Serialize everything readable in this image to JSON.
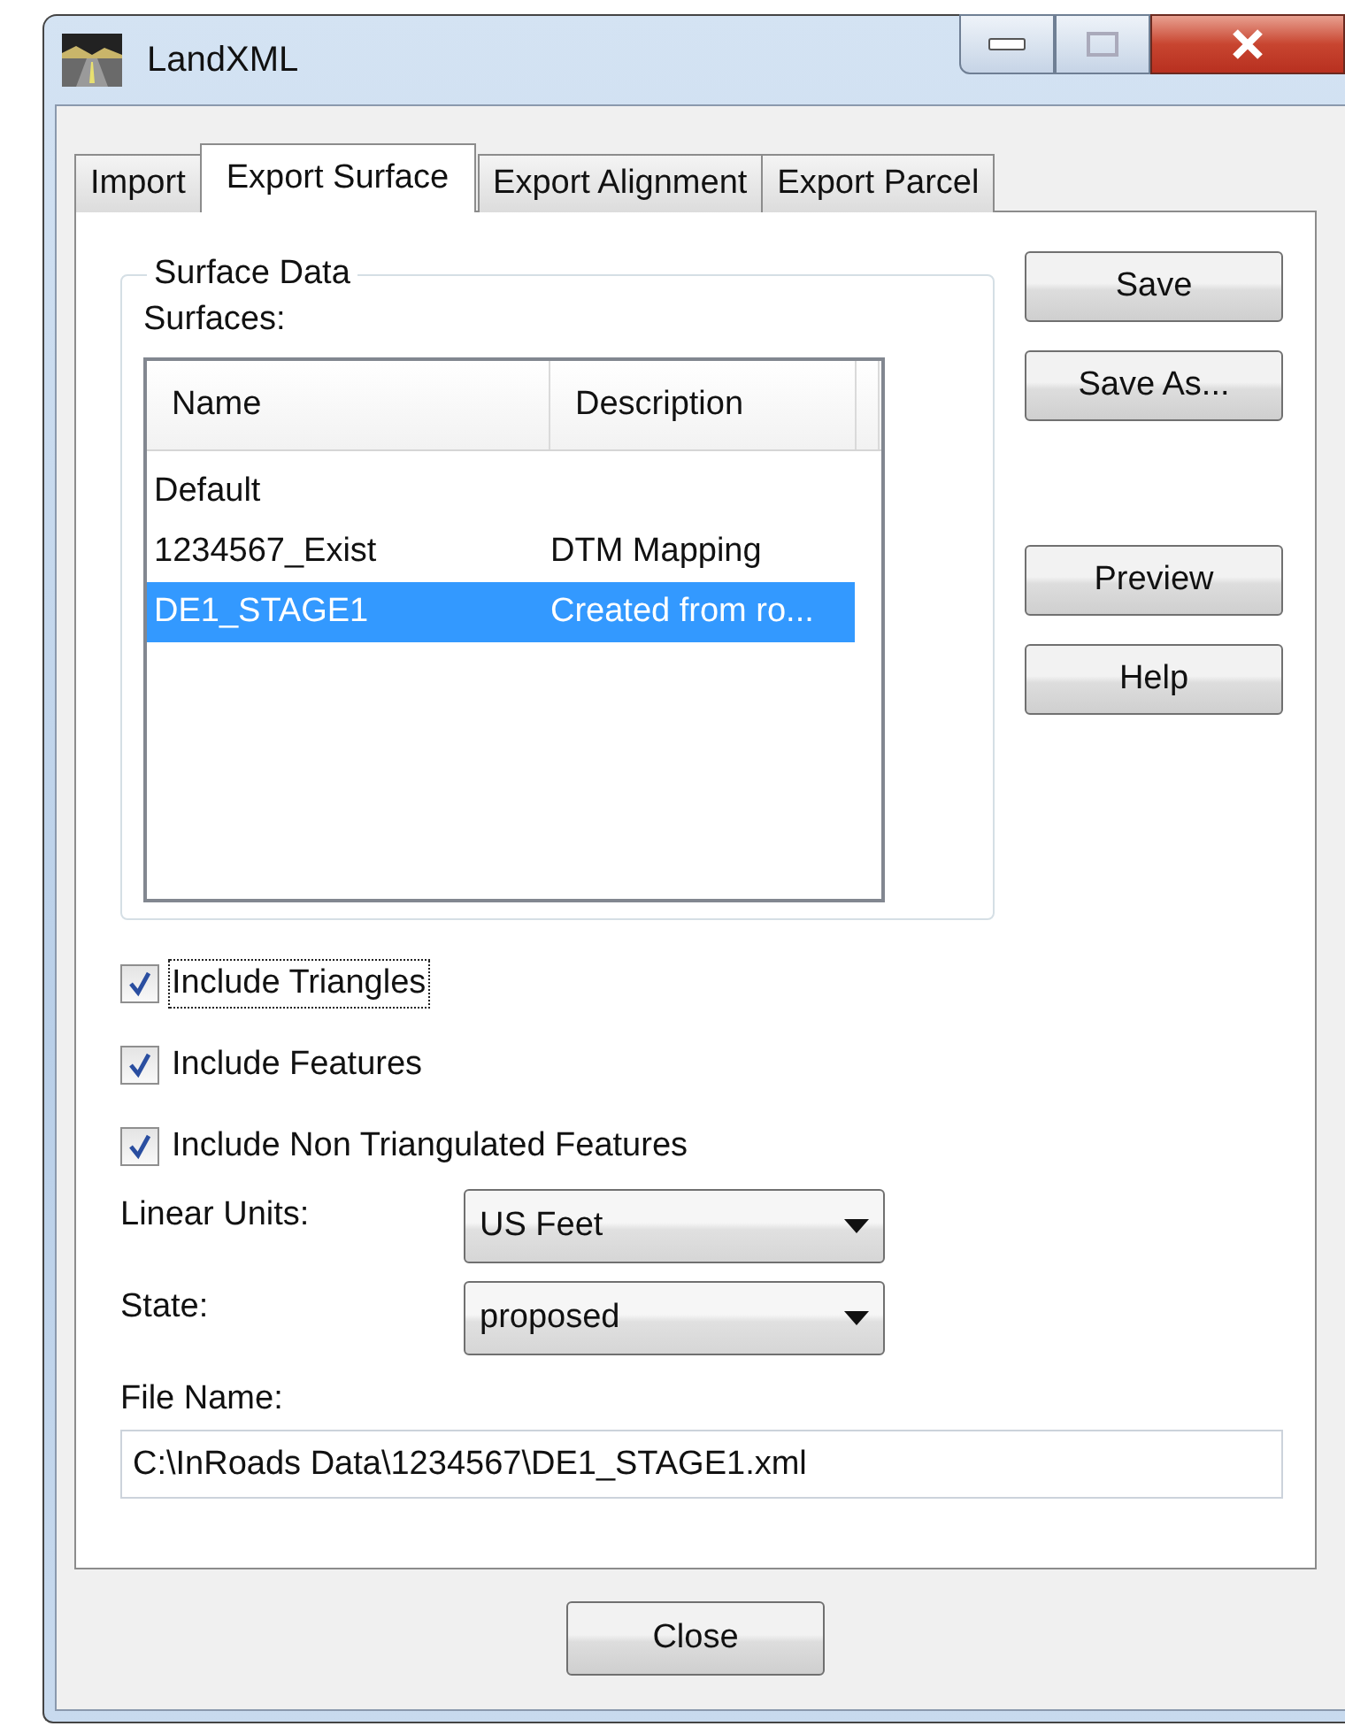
{
  "window": {
    "title": "LandXML"
  },
  "tabs": [
    {
      "label": "Import",
      "selected": false
    },
    {
      "label": "Export Surface",
      "selected": true
    },
    {
      "label": "Export Alignment",
      "selected": false
    },
    {
      "label": "Export Parcel",
      "selected": false
    }
  ],
  "surface_data": {
    "title": "Surface Data",
    "list_label": "Surfaces:",
    "columns": [
      "Name",
      "Description"
    ],
    "rows": [
      {
        "name": "Default",
        "selected": false
      },
      {
        "name": "1234567_Exist",
        "description": "DTM Mapping",
        "selected": false
      },
      {
        "name": "DE1_STAGE1",
        "description": "Created from ro...",
        "selected": true
      }
    ]
  },
  "file_buttons": [
    "Save",
    "Save As..."
  ],
  "help_buttons": [
    "Preview",
    "Help"
  ],
  "options": [
    {
      "label": "Include Triangles",
      "checked": true,
      "focused": true
    },
    {
      "label": "Include Features",
      "checked": true,
      "focused": false
    },
    {
      "label": "Include Non Triangulated Features",
      "checked": true,
      "focused": false
    }
  ],
  "dropdowns": [
    {
      "label": "Linear Units:",
      "value": "US Feet"
    },
    {
      "label": "State:",
      "value": "proposed"
    }
  ],
  "file_name": {
    "label": "File Name:",
    "value": "C:\\InRoads Data\\1234567\\DE1_STAGE1.xml"
  },
  "close_button": "Close"
}
